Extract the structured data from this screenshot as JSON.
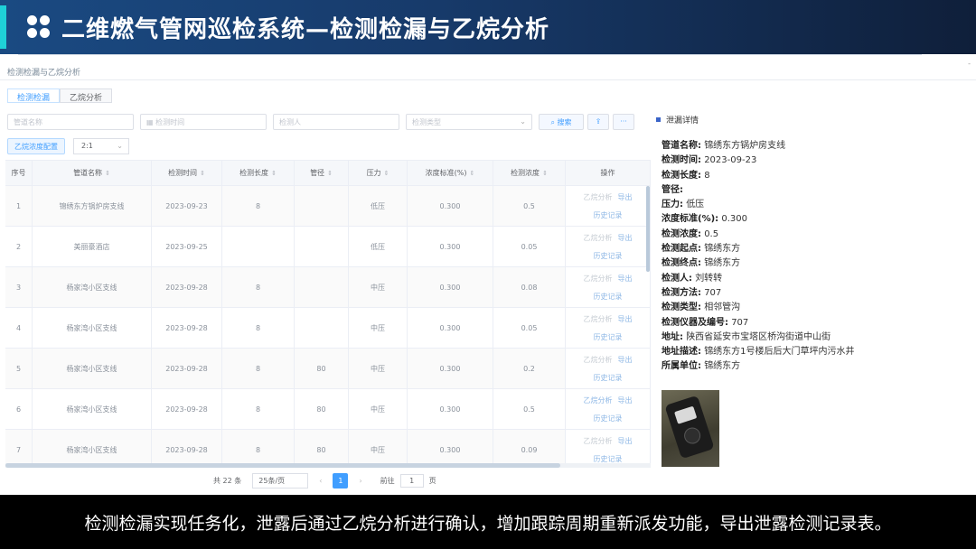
{
  "banner": {
    "title": "二维燃气管网巡检系统—检测检漏与乙烷分析"
  },
  "app": {
    "title": "检测检漏与乙烷分析",
    "window_controls": "-"
  },
  "tabs": [
    {
      "label": "检测检漏",
      "active": true
    },
    {
      "label": "乙烷分析",
      "active": false
    }
  ],
  "filters": {
    "pipeline_name_placeholder": "管道名称",
    "check_time_placeholder": "检测时间",
    "inspector_placeholder": "检测人",
    "check_type_placeholder": "检测类型",
    "search_label": "搜索",
    "more_label": "···"
  },
  "toolbar": {
    "ethane_config_label": "乙烷浓度配置",
    "ratio_value": "2:1"
  },
  "table": {
    "headers": [
      "序号",
      "管道名称",
      "检测时间",
      "检测长度",
      "管径",
      "压力",
      "浓度标准(%)",
      "检测浓度",
      "操作"
    ],
    "rows": [
      {
        "no": "1",
        "name": "锦绣东方锅炉房支线",
        "date": "2023-09-23",
        "length": "8",
        "diameter": "",
        "pressure": "低压",
        "standard": "0.300",
        "conc": "0.5"
      },
      {
        "no": "2",
        "name": "美丽豪酒店",
        "date": "2023-09-25",
        "length": "",
        "diameter": "",
        "pressure": "低压",
        "standard": "0.300",
        "conc": "0.05"
      },
      {
        "no": "3",
        "name": "杨家湾小区支线",
        "date": "2023-09-28",
        "length": "8",
        "diameter": "",
        "pressure": "中压",
        "standard": "0.300",
        "conc": "0.08"
      },
      {
        "no": "4",
        "name": "杨家湾小区支线",
        "date": "2023-09-28",
        "length": "8",
        "diameter": "",
        "pressure": "中压",
        "standard": "0.300",
        "conc": "0.05"
      },
      {
        "no": "5",
        "name": "杨家湾小区支线",
        "date": "2023-09-28",
        "length": "8",
        "diameter": "80",
        "pressure": "中压",
        "standard": "0.300",
        "conc": "0.2"
      },
      {
        "no": "6",
        "name": "杨家湾小区支线",
        "date": "2023-09-28",
        "length": "8",
        "diameter": "80",
        "pressure": "中压",
        "standard": "0.300",
        "conc": "0.5"
      },
      {
        "no": "7",
        "name": "杨家湾小区支线",
        "date": "2023-09-28",
        "length": "8",
        "diameter": "80",
        "pressure": "中压",
        "standard": "0.300",
        "conc": "0.09"
      }
    ],
    "op_ethane": "乙烷分析",
    "op_export": "导出",
    "op_history": "历史记录"
  },
  "pagination": {
    "total": "共 22 条",
    "page_size": "25条/页",
    "current_page": "1",
    "goto_label": "前往",
    "goto_value": "1",
    "unit": "页"
  },
  "detail": {
    "title": "泄漏详情",
    "fields": [
      {
        "label": "管道名称:",
        "value": "锦绣东方锅炉房支线"
      },
      {
        "label": "检测时间:",
        "value": "2023-09-23"
      },
      {
        "label": "检测长度:",
        "value": "8"
      },
      {
        "label": "管径:",
        "value": ""
      },
      {
        "label": "压力:",
        "value": "低压"
      },
      {
        "label": "浓度标准(%):",
        "value": "0.300"
      },
      {
        "label": "检测浓度:",
        "value": "0.5"
      },
      {
        "label": "检测起点:",
        "value": "锦绣东方"
      },
      {
        "label": "检测终点:",
        "value": "锦绣东方"
      },
      {
        "label": "检测人:",
        "value": "刘转转"
      },
      {
        "label": "检测方法:",
        "value": "707"
      },
      {
        "label": "检测类型:",
        "value": "相邻管沟"
      },
      {
        "label": "检测仪器及编号:",
        "value": "707"
      },
      {
        "label": "地址:",
        "value": "陕西省延安市宝塔区桥沟街道中山街"
      },
      {
        "label": "地址描述:",
        "value": "锦绣东方1号楼后后大门草坪内污水井"
      },
      {
        "label": "所属单位:",
        "value": "锦绣东方"
      }
    ]
  },
  "caption": "检测检漏实现任务化，泄露后通过乙烷分析进行确认，增加跟踪周期重新派发功能，导出泄露检测记录表。"
}
